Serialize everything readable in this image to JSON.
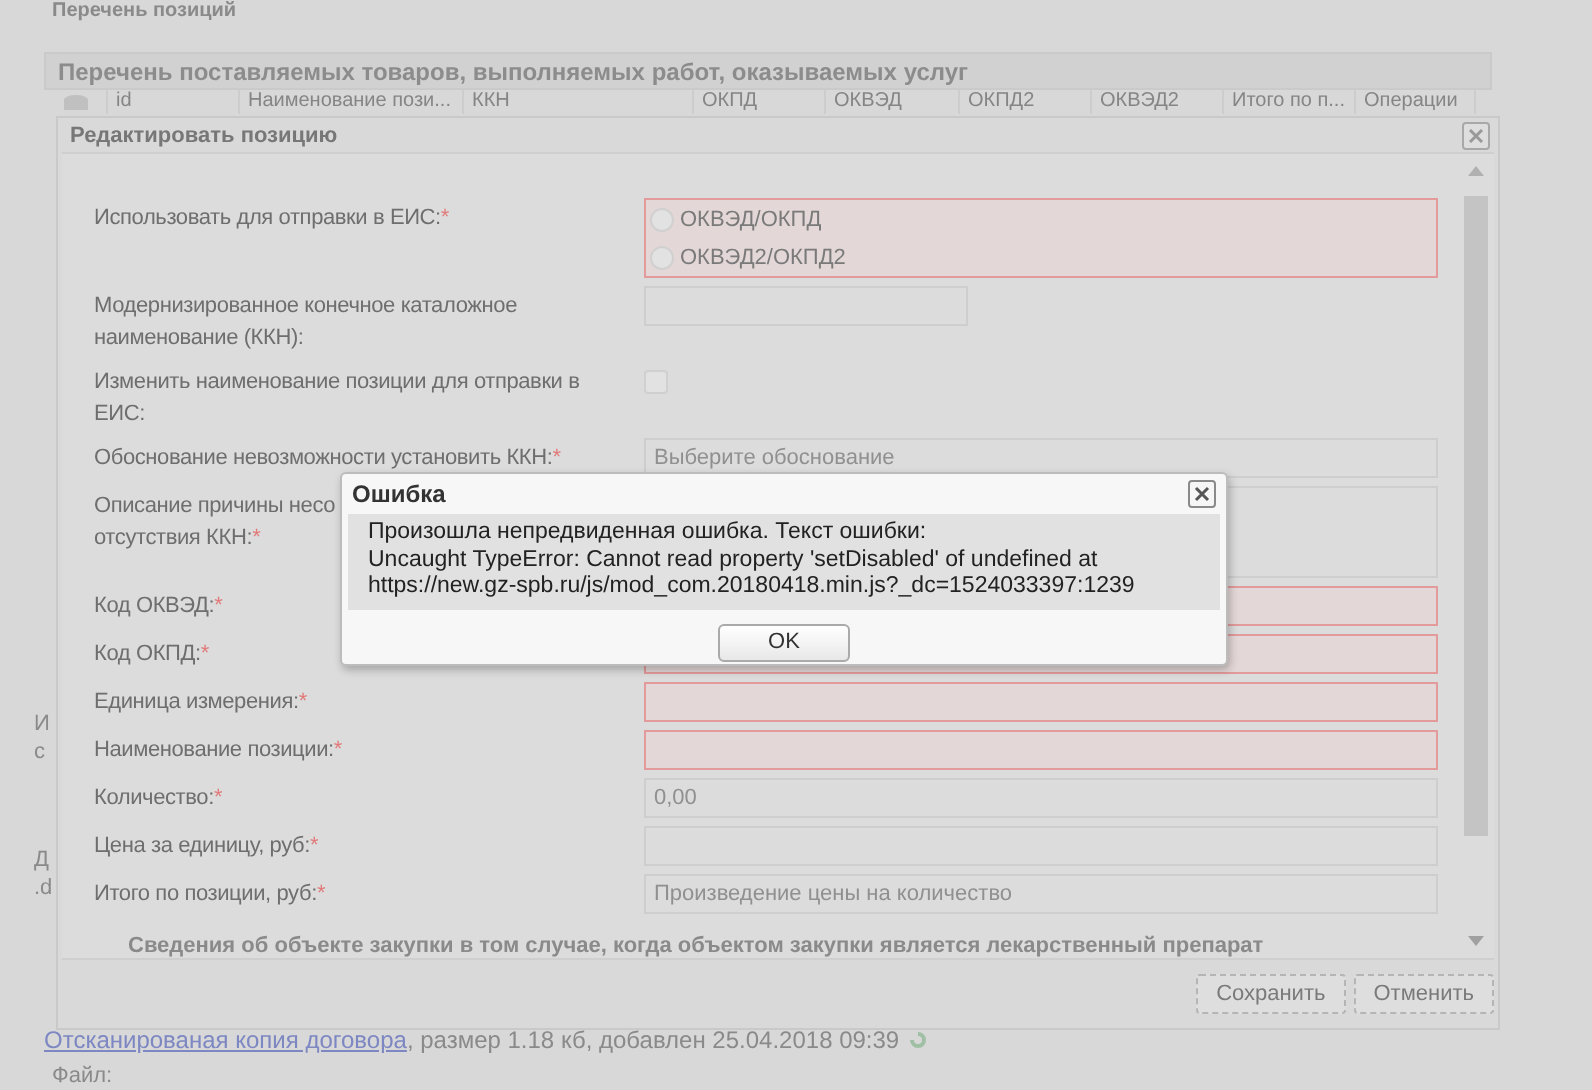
{
  "page": {
    "title": "Перечень позиций",
    "section_title": "Перечень поставляемых товаров, выполняемых работ, оказываемых услуг",
    "columns": [
      {},
      {
        "label": "id"
      },
      {
        "label": "Наименование пози..."
      },
      {
        "label": "ККН"
      },
      {
        "label": "ОКПД"
      },
      {
        "label": "ОКВЭД"
      },
      {
        "label": "ОКПД2"
      },
      {
        "label": "ОКВЭД2"
      },
      {
        "label": "Итого по п..."
      },
      {
        "label": "Операции"
      }
    ],
    "side_fragments": [
      [
        "И",
        "с"
      ],
      [
        "Д",
        ".d"
      ]
    ],
    "attachment": {
      "link": "Отсканированая копия договора",
      "info": ", размер 1.18 кб, добавлен 25.04.2018 09:39"
    },
    "file_label": "Файл:"
  },
  "edit_window": {
    "title": "Редактировать позицию",
    "rows": [
      {
        "kind": "radio_group",
        "label_lines": [
          "Использовать для отправки в ЕИС:"
        ],
        "mark": "*",
        "invalid": true,
        "options": [
          {
            "label": "ОКВЭД/ОКПД",
            "selected": false
          },
          {
            "label": "ОКВЭД2/ОКПД2",
            "selected": false
          }
        ]
      },
      {
        "kind": "short_text",
        "label_lines": [
          "Модернизированное конечное каталожное",
          "наименование (ККН):"
        ],
        "invalid": false
      },
      {
        "kind": "checkbox",
        "label_lines": [
          "Изменить наименование позиции для отправки в",
          "ЕИС:"
        ],
        "checked": false
      },
      {
        "kind": "combo",
        "label_lines": [
          "Обоснование невозможности установить ККН:"
        ],
        "mark": "*",
        "invalid": false,
        "placeholder": "Выберите обоснование"
      },
      {
        "kind": "textarea",
        "label_lines": [
          "Описание причины несо",
          "отсутствия ККН:"
        ],
        "mark": "*",
        "invalid": false
      },
      {
        "kind": "text",
        "label_lines": [
          "Код ОКВЭД:"
        ],
        "mark": "*",
        "invalid": true
      },
      {
        "kind": "text",
        "label_lines": [
          "Код ОКПД:"
        ],
        "mark": "*",
        "invalid": true
      },
      {
        "kind": "text",
        "label_lines": [
          "Единица измерения:"
        ],
        "mark": "*",
        "invalid": true
      },
      {
        "kind": "text",
        "label_lines": [
          "Наименование позиции:"
        ],
        "mark": "*",
        "invalid": true
      },
      {
        "kind": "text",
        "label_lines": [
          "Количество:"
        ],
        "mark": "*",
        "invalid": false,
        "placeholder": "0,00"
      },
      {
        "kind": "text",
        "label_lines": [
          "Цена за единицу, руб:"
        ],
        "mark": "*",
        "invalid": false
      },
      {
        "kind": "text",
        "label_lines": [
          "Итого по позиции, руб:"
        ],
        "mark": "*",
        "invalid": false,
        "placeholder": "Произведение цены на количество"
      }
    ],
    "subheading": "Сведения об объекте закупки в том случае, когда объектом закупки является лекарственный препарат",
    "buttons": [
      "Сохранить",
      "Отменить"
    ]
  },
  "error_dialog": {
    "title": "Ошибка",
    "message": "Произошла непредвиденная ошибка. Текст ошибки:",
    "details": "Uncaught TypeError: Cannot read property 'setDisabled' of undefined at https://new.gz-spb.ru/js/mod_com.20180418.min.js?_dc=1524033397:1239",
    "button": "OK"
  }
}
